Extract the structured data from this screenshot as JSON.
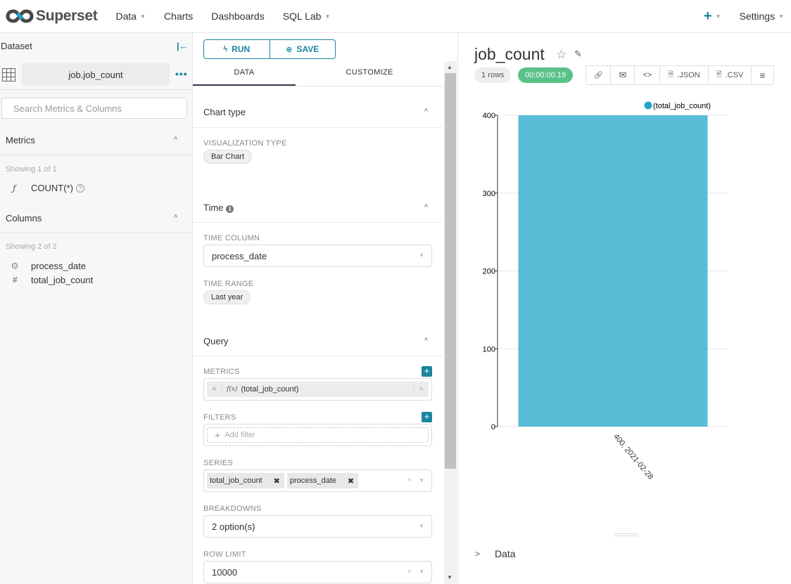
{
  "nav": {
    "brand": "Superset",
    "items": [
      {
        "label": "Data",
        "has_caret": true
      },
      {
        "label": "Charts",
        "has_caret": false
      },
      {
        "label": "Dashboards",
        "has_caret": false
      },
      {
        "label": "SQL Lab",
        "has_caret": true
      }
    ],
    "plus_icon": "+",
    "settings_label": "Settings",
    "caret": "▼",
    "colors": {
      "brand_dark": "#484848",
      "brand_accent": "#20a7c9"
    }
  },
  "left": {
    "dataset_label": "Dataset",
    "collapse_icon": "|←",
    "dataset_name": "job.job_count",
    "more_icon": "•••",
    "search_placeholder": "Search Metrics & Columns",
    "metrics_title": "Metrics",
    "metrics_showing": "Showing 1 of 1",
    "metrics": [
      {
        "icon": "ƒ",
        "label": "COUNT(*)",
        "help": "?"
      }
    ],
    "columns_title": "Columns",
    "columns_showing": "Showing 2 of 2",
    "columns": [
      {
        "icon": "⊙",
        "label": "process_date"
      },
      {
        "icon": "#",
        "label": "total_job_count"
      }
    ],
    "chevron_up": "^"
  },
  "middle": {
    "run_label": "RUN",
    "run_icon": "ϟ",
    "save_label": "SAVE",
    "save_icon": "⊕",
    "tabs": [
      {
        "label": "DATA",
        "active": true
      },
      {
        "label": "CUSTOMIZE",
        "active": false
      }
    ],
    "chevron_up": "^",
    "sections": {
      "chart_type": {
        "title": "Chart type",
        "viz_label": "VISUALIZATION TYPE",
        "viz_value": "Bar Chart"
      },
      "time": {
        "title": "Time",
        "info_icon": "ℹ",
        "time_column_label": "TIME COLUMN",
        "time_column_value": "process_date",
        "time_range_label": "TIME RANGE",
        "time_range_value": "Last year"
      },
      "query": {
        "title": "Query",
        "metrics_label": "METRICS",
        "metric_value": "(total_job_count)",
        "metric_fx": "f(x)",
        "filters_label": "FILTERS",
        "add_filter_placeholder": "Add filter",
        "series_label": "SERIES",
        "series_values": [
          "total_job_count",
          "process_date"
        ],
        "breakdowns_label": "BREAKDOWNS",
        "breakdowns_value": "2 option(s)",
        "row_limit_label": "ROW LIMIT",
        "row_limit_value": "10000"
      }
    },
    "add_icon": "+",
    "remove_icon": "×",
    "tag_remove_icon": "✖",
    "arrow_right": ">",
    "dropdown_caret": "▼",
    "scroll_up": "▲",
    "scroll_down": "▼"
  },
  "right": {
    "chart_title": "job_count",
    "star_icon": "☆",
    "edit_icon": "✎",
    "rows_badge": "1 rows",
    "time_badge": "00:00:00.19",
    "actions": [
      {
        "name": "link",
        "icon": "🔗",
        "label": ""
      },
      {
        "name": "email",
        "icon": "✉",
        "label": ""
      },
      {
        "name": "embed",
        "icon": "<>",
        "label": ""
      },
      {
        "name": "json",
        "icon": "🗎",
        "label": ".JSON"
      },
      {
        "name": "csv",
        "icon": "🗎",
        "label": ".CSV"
      },
      {
        "name": "menu",
        "icon": "≡",
        "label": ""
      }
    ],
    "data_toggle_label": "Data",
    "data_toggle_icon": ">"
  },
  "chart_data": {
    "type": "bar",
    "title": "",
    "categories": [
      "400, 2021-02-28"
    ],
    "series": [
      {
        "name": "(total_job_count)",
        "values": [
          400
        ],
        "color": "#20a7c9"
      }
    ],
    "xlabel": "",
    "ylabel": "",
    "ylim": [
      0,
      400
    ],
    "yticks": [
      0,
      100,
      200,
      300,
      400
    ],
    "grid": true,
    "legend": "top-right"
  }
}
